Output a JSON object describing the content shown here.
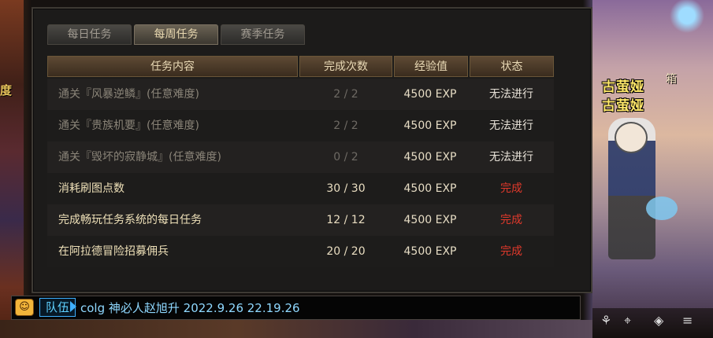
{
  "tabs": [
    "每日任务",
    "每周任务",
    "赛季任务"
  ],
  "active_tab": 1,
  "columns": [
    "任务内容",
    "完成次数",
    "经验值",
    "状态"
  ],
  "rows": [
    {
      "task": "通关『风暴逆鳞』(任意难度)",
      "count": "2 / 2",
      "exp": "4500 EXP",
      "status": "无法进行"
    },
    {
      "task": "通关『贵族机要』(任意难度)",
      "count": "2 / 2",
      "exp": "4500 EXP",
      "status": "无法进行"
    },
    {
      "task": "通关『毁坏的寂静城』(任意难度)",
      "count": "0 / 2",
      "exp": "4500 EXP",
      "status": "无法进行"
    },
    {
      "task": "消耗刷图点数",
      "count": "30 / 30",
      "exp": "4500 EXP",
      "status": "完成"
    },
    {
      "task": "完成畅玩任务系统的每日任务",
      "count": "12 / 12",
      "exp": "4500 EXP",
      "status": "完成"
    },
    {
      "task": "在阿拉德冒险招募佣兵",
      "count": "20 / 20",
      "exp": "4500 EXP",
      "status": "完成"
    }
  ],
  "chat": {
    "channel": "队伍",
    "text": "colg 神必人赵旭升 2022.9.26 22.19.26"
  },
  "scene": {
    "left_label": "度",
    "right_sign": "箱",
    "character_name_1": "古萤娅",
    "character_name_2": "古萤娅"
  },
  "colors": {
    "done": "#e0392b",
    "header_bg": "#5e4a34",
    "chat_channel": "#3fb0ff"
  }
}
